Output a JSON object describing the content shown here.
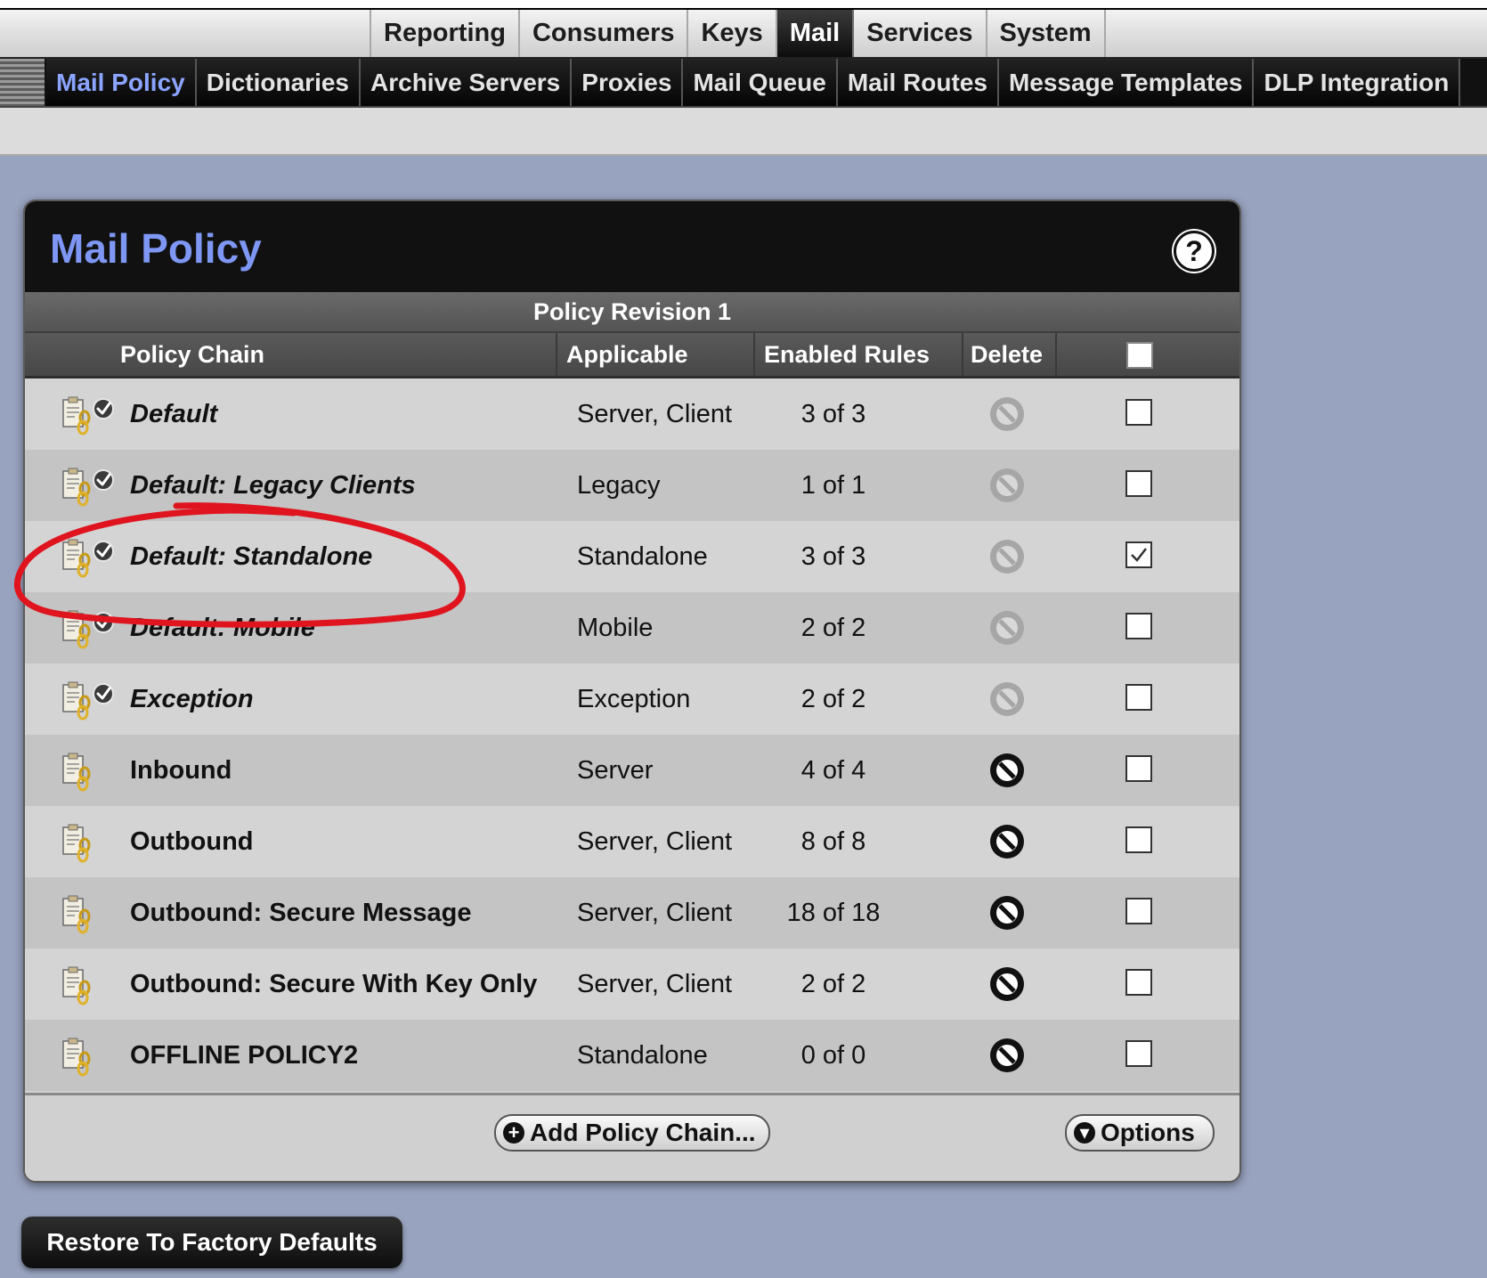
{
  "top_tabs": [
    {
      "label": "Reporting",
      "active": false
    },
    {
      "label": "Consumers",
      "active": false
    },
    {
      "label": "Keys",
      "active": false
    },
    {
      "label": "Mail",
      "active": true
    },
    {
      "label": "Services",
      "active": false
    },
    {
      "label": "System",
      "active": false
    }
  ],
  "sub_tabs": [
    {
      "label": "Mail Policy",
      "active": true
    },
    {
      "label": "Dictionaries",
      "active": false
    },
    {
      "label": "Archive Servers",
      "active": false
    },
    {
      "label": "Proxies",
      "active": false
    },
    {
      "label": "Mail Queue",
      "active": false
    },
    {
      "label": "Mail Routes",
      "active": false
    },
    {
      "label": "Message Templates",
      "active": false
    },
    {
      "label": "DLP Integration",
      "active": false
    }
  ],
  "panel": {
    "title": "Mail Policy",
    "help_icon": "?",
    "revision": "Policy Revision 1",
    "columns": {
      "policy_chain": "Policy Chain",
      "applicable": "Applicable",
      "enabled_rules": "Enabled Rules",
      "delete": "Delete"
    },
    "rows": [
      {
        "name": "Default",
        "applicable": "Server, Client",
        "enabled": "3 of 3",
        "italic": true,
        "system_default": true,
        "delete_enabled": false,
        "checked": false
      },
      {
        "name": "Default: Legacy Clients",
        "applicable": "Legacy",
        "enabled": "1 of 1",
        "italic": true,
        "system_default": true,
        "delete_enabled": false,
        "checked": false
      },
      {
        "name": "Default: Standalone",
        "applicable": "Standalone",
        "enabled": "3 of 3",
        "italic": true,
        "system_default": true,
        "delete_enabled": false,
        "checked": true
      },
      {
        "name": "Default: Mobile",
        "applicable": "Mobile",
        "enabled": "2 of 2",
        "italic": true,
        "system_default": true,
        "delete_enabled": false,
        "checked": false
      },
      {
        "name": "Exception",
        "applicable": "Exception",
        "enabled": "2 of 2",
        "italic": true,
        "system_default": true,
        "delete_enabled": false,
        "checked": false
      },
      {
        "name": "Inbound",
        "applicable": "Server",
        "enabled": "4 of 4",
        "italic": false,
        "system_default": false,
        "delete_enabled": true,
        "checked": false
      },
      {
        "name": "Outbound",
        "applicable": "Server, Client",
        "enabled": "8 of 8",
        "italic": false,
        "system_default": false,
        "delete_enabled": true,
        "checked": false
      },
      {
        "name": "Outbound: Secure Message",
        "applicable": "Server, Client",
        "enabled": "18 of 18",
        "italic": false,
        "system_default": false,
        "delete_enabled": true,
        "checked": false
      },
      {
        "name": "Outbound: Secure With Key Only",
        "applicable": "Server, Client",
        "enabled": "2 of 2",
        "italic": false,
        "system_default": false,
        "delete_enabled": true,
        "checked": false
      },
      {
        "name": "OFFLINE POLICY2",
        "applicable": "Standalone",
        "enabled": "0 of 0",
        "italic": false,
        "system_default": false,
        "delete_enabled": true,
        "checked": false
      }
    ],
    "add_button": "Add Policy Chain...",
    "options_button": "Options"
  },
  "restore_button": "Restore To Factory Defaults",
  "colors": {
    "page_bg": "#98a3bf",
    "title_blue": "#7e97f4",
    "active_subtab": "#8ba4ff",
    "annotation_red": "#e0141e"
  },
  "icons": {
    "policy": "policy-chain-icon",
    "system_badge": "check-badge-icon",
    "delete": "no-entry-icon",
    "add": "plus-circle-icon",
    "options": "chevron-down-circle-icon"
  }
}
